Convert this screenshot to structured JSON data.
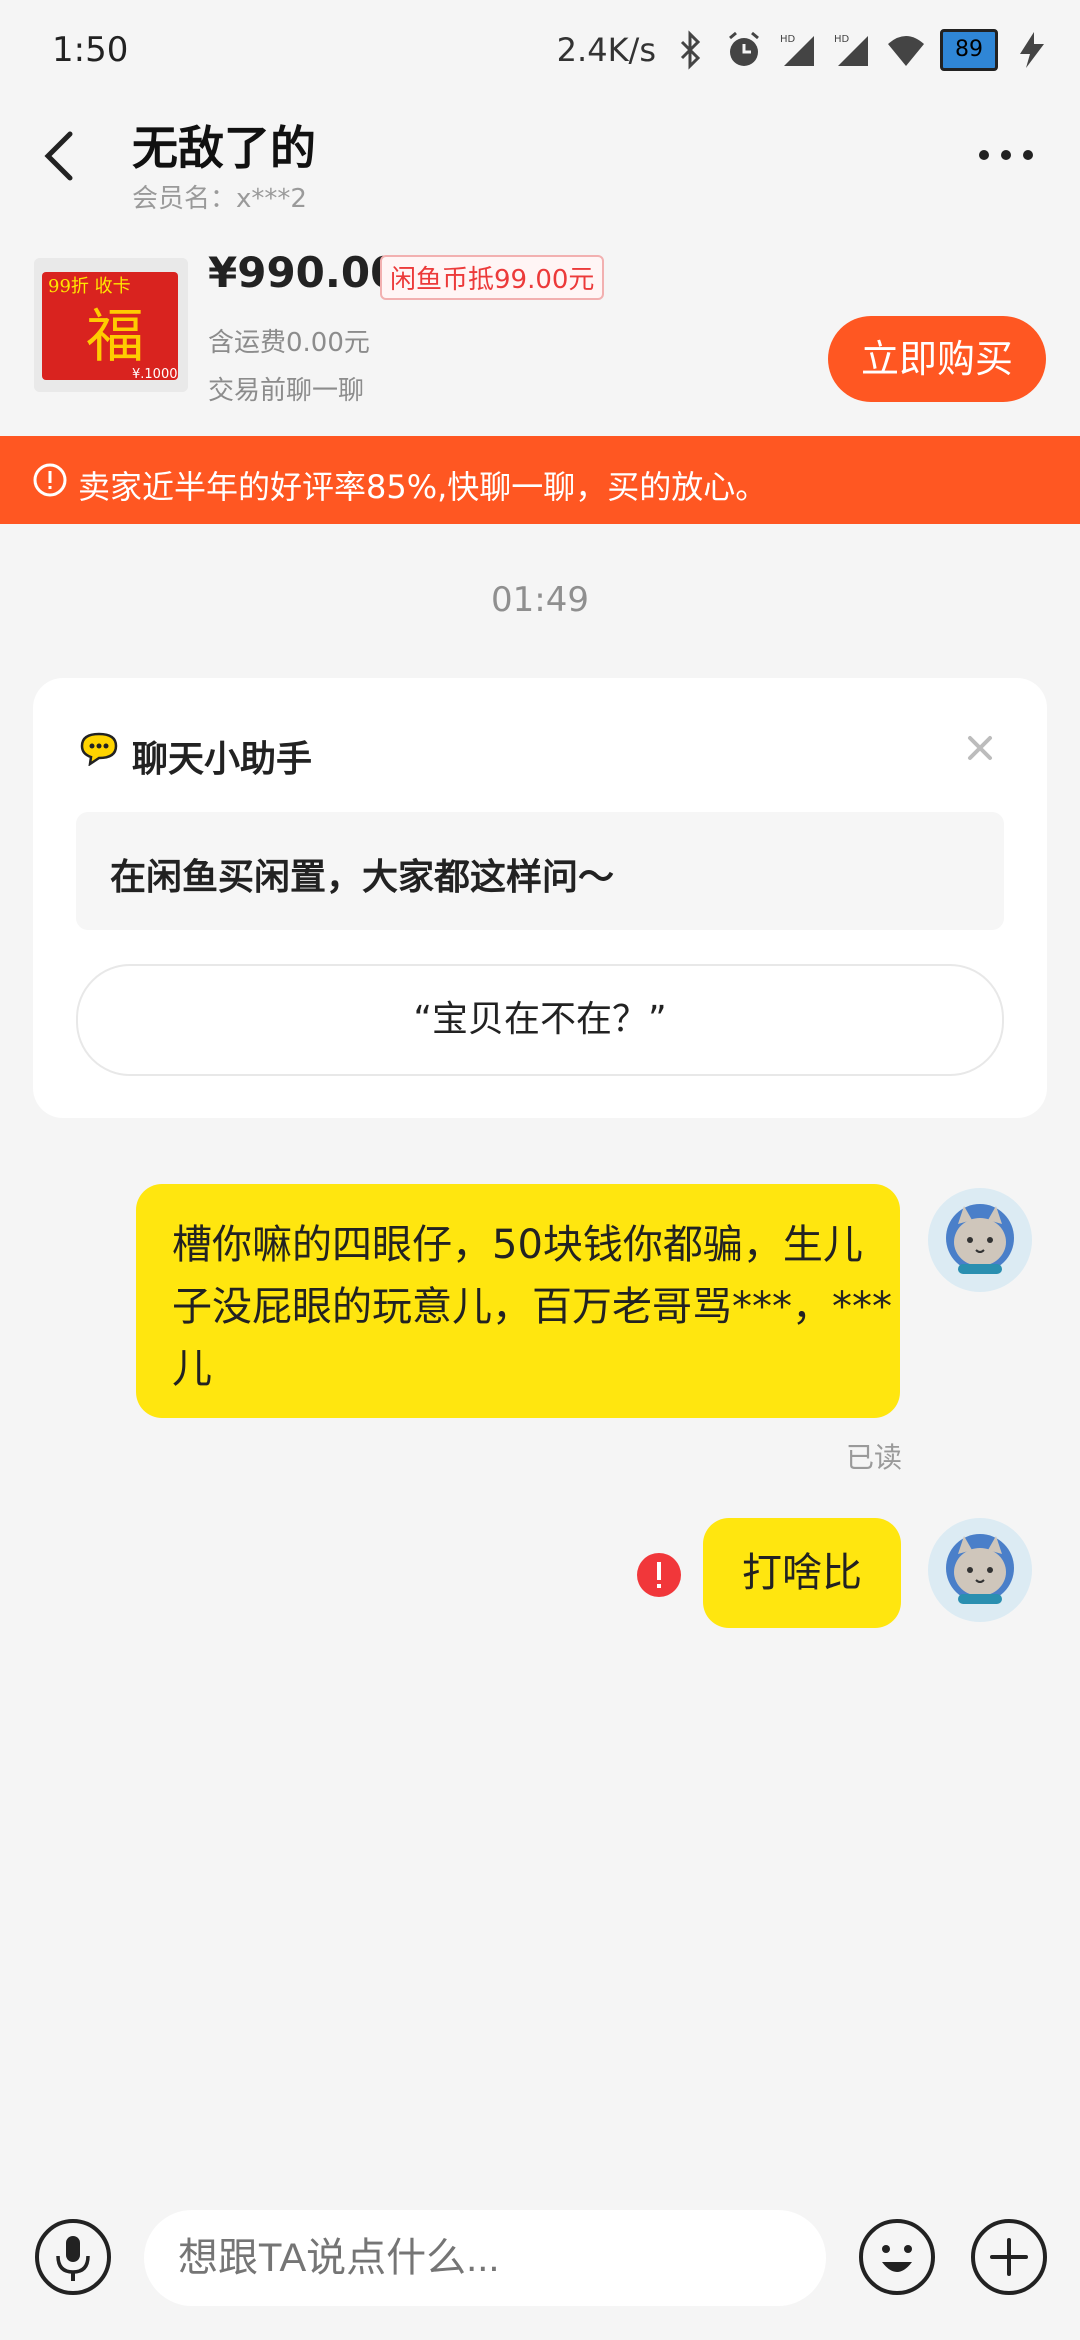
{
  "status_bar": {
    "time": "1:50",
    "net_speed": "2.4K/s",
    "battery": "89",
    "icons": [
      "bluetooth-icon",
      "alarm-icon",
      "hd-signal-icon",
      "hd-signal-icon",
      "wifi-icon",
      "battery-icon",
      "charging-icon"
    ]
  },
  "header": {
    "title": "无敌了的",
    "member_label": "会员名：x***2",
    "back_icon": "back-arrow-icon",
    "more_icon": "more-dots-icon"
  },
  "product": {
    "price": "¥990.00",
    "coin_discount": "闲鱼币抵99.00元",
    "shipping": "含运费0.00元",
    "note": "交易前聊一聊",
    "buy_label": "立即购买",
    "image_text": {
      "top": "99折 收卡",
      "main": "福",
      "value": "¥.1000"
    }
  },
  "banner": {
    "text": "卖家近半年的好评率85%,快聊一聊，买的放心。",
    "icon": "warning-icon"
  },
  "chat_time": "01:49",
  "assistant": {
    "title": "聊天小助手",
    "subtitle": "在闲鱼买闲置，大家都这样问～",
    "suggestion": "“宝贝在不在？”"
  },
  "messages": [
    {
      "text": "槽你嘛的四眼仔，50块钱你都骗，生儿子没屁眼的玩意儿，百万老哥骂***，***儿",
      "status": "已读"
    },
    {
      "text": "打啥比",
      "status": "failed"
    }
  ],
  "input": {
    "placeholder": "想跟TA说点什么..."
  },
  "colors": {
    "accent": "#ff5722",
    "bubble": "#ffe60f",
    "background": "#f5f5f5"
  }
}
